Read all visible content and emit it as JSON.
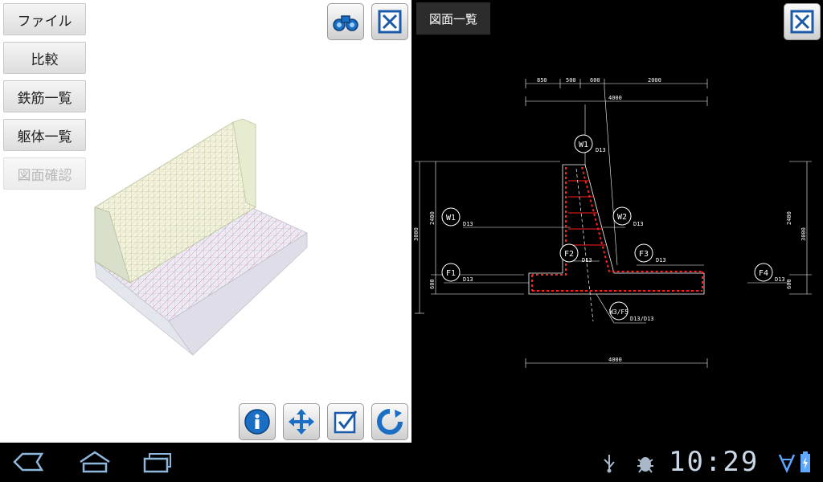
{
  "left_menu": {
    "items": [
      {
        "label": "ファイル",
        "enabled": true
      },
      {
        "label": "比較",
        "enabled": true
      },
      {
        "label": "鉄筋一覧",
        "enabled": true
      },
      {
        "label": "躯体一覧",
        "enabled": true
      },
      {
        "label": "図面確認",
        "enabled": false
      }
    ]
  },
  "left_toolbar_top": [
    "binoculars-icon",
    "close-view-icon"
  ],
  "left_toolbar_bottom": [
    "info-icon",
    "move-icon",
    "check-icon",
    "rotate-icon"
  ],
  "right_panel": {
    "title": "図面一覧"
  },
  "drawing": {
    "dims_top": [
      "850",
      "500",
      "600",
      "2000"
    ],
    "dim_total_top": "4000",
    "dim_total_bottom": "4000",
    "dim_left_height": "3000",
    "dim_left_upper": "2400",
    "dim_left_lower": "600",
    "dim_right_height": "3000",
    "dim_right_upper": "2400",
    "dim_right_lower": "600",
    "labels": [
      {
        "tag": "W1",
        "rebar": "D13"
      },
      {
        "tag": "W1",
        "rebar": "D13"
      },
      {
        "tag": "W2",
        "rebar": "D13"
      },
      {
        "tag": "F2",
        "rebar": "D13"
      },
      {
        "tag": "F3",
        "rebar": "D13"
      },
      {
        "tag": "F1",
        "rebar": "D13"
      },
      {
        "tag": "F4",
        "rebar": "D13"
      },
      {
        "tag": "W3/F5",
        "rebar": "D13/D13"
      }
    ]
  },
  "status_bar": {
    "time": "10:29"
  },
  "colors": {
    "rebar": "#ff2020",
    "lines": "#ffffff",
    "icon_blue": "#1a6fc4"
  }
}
